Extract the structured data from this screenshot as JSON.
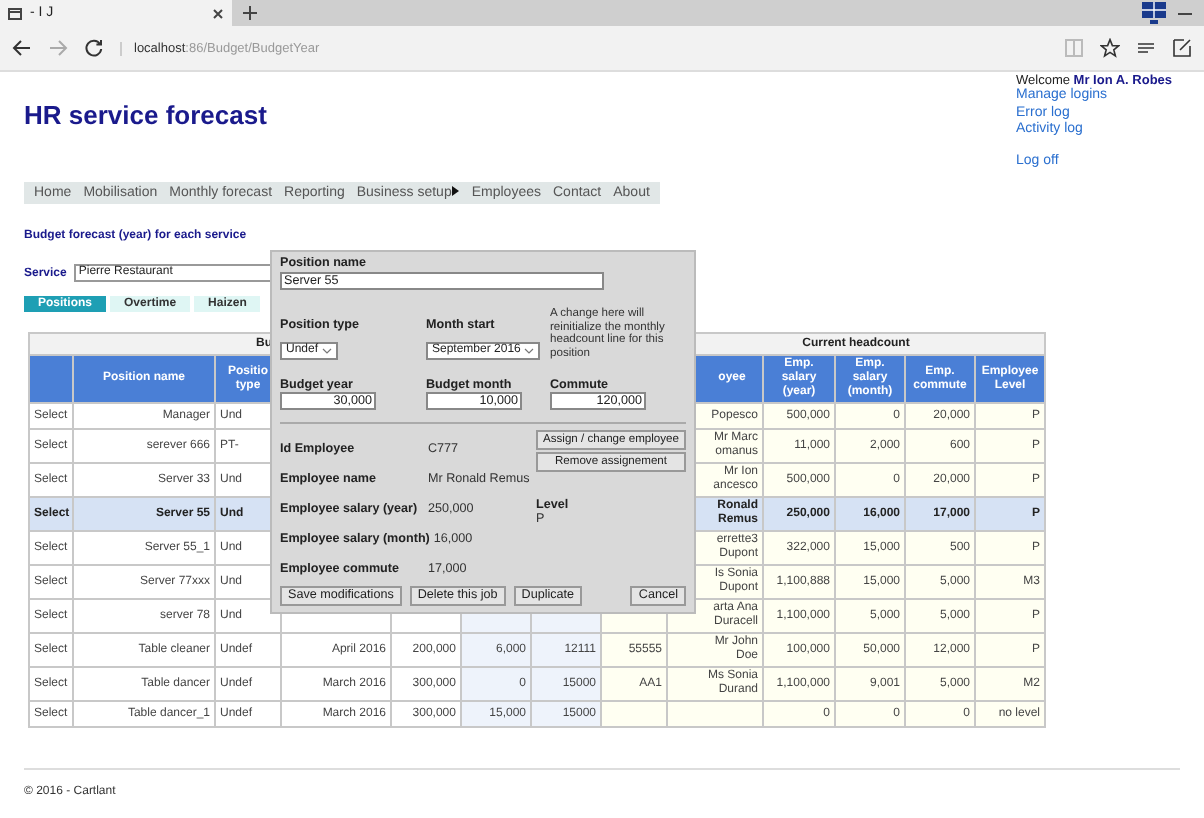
{
  "browser": {
    "tab_title": "- I J",
    "url_host": "localhost",
    "url_path": ":86/Budget/BudgetYear"
  },
  "header": {
    "title": "HR service forecast",
    "welcome": "Welcome",
    "user": "Mr Ion A. Robes",
    "links": [
      "Manage logins",
      "Error log",
      "Activity log"
    ],
    "logoff": "Log off"
  },
  "nav": [
    {
      "label": "Home",
      "submenu": false
    },
    {
      "label": "Mobilisation",
      "submenu": false
    },
    {
      "label": "Monthly forecast",
      "submenu": false
    },
    {
      "label": "Reporting",
      "submenu": false
    },
    {
      "label": "Business setup",
      "submenu": true
    },
    {
      "label": "Employees",
      "submenu": false
    },
    {
      "label": "Contact",
      "submenu": false
    },
    {
      "label": "About",
      "submenu": false
    }
  ],
  "section_title": "Budget forecast (year) for each service",
  "service": {
    "label": "Service",
    "value": "Pierre Restaurant"
  },
  "tabs": [
    {
      "label": "Positions",
      "selected": true
    },
    {
      "label": "Overtime",
      "selected": false
    },
    {
      "label": "Haizen",
      "selected": false
    }
  ],
  "table": {
    "groups": [
      {
        "label": "Bu"
      },
      {
        "label": "Current headcount"
      }
    ],
    "headers": {
      "position_name": "Position name",
      "position_type": "Positio type",
      "employee": "oyee",
      "emp_salary_year": "Emp. salary (year)",
      "emp_salary_month": "Emp. salary (month)",
      "emp_commute": "Emp. commute",
      "employee_level": "Employee Level"
    },
    "rows": [
      {
        "selected": false,
        "select": "Select",
        "position_name": "Manager",
        "position_type": "Und",
        "employee": "Popesco",
        "emp_salary_year": "500,000",
        "emp_salary_month": "0",
        "emp_commute": "20,000",
        "employee_level": "P"
      },
      {
        "selected": false,
        "select": "Select",
        "position_name": "serever 666",
        "position_type": "PT-",
        "employee": "Mr Marc omanus",
        "emp_salary_year": "11,000",
        "emp_salary_month": "2,000",
        "emp_commute": "600",
        "employee_level": "P"
      },
      {
        "selected": false,
        "select": "Select",
        "position_name": "Server 33",
        "position_type": "Und",
        "employee": "Mr Ion ancesco",
        "emp_salary_year": "500,000",
        "emp_salary_month": "0",
        "emp_commute": "20,000",
        "employee_level": "P"
      },
      {
        "selected": true,
        "select": "Select",
        "position_name": "Server 55",
        "position_type": "Und",
        "employee": "Ronald Remus",
        "emp_salary_year": "250,000",
        "emp_salary_month": "16,000",
        "emp_commute": "17,000",
        "employee_level": "P"
      },
      {
        "selected": false,
        "select": "Select",
        "position_name": "Server 55_1",
        "position_type": "Und",
        "employee": "errette3 Dupont",
        "emp_salary_year": "322,000",
        "emp_salary_month": "15,000",
        "emp_commute": "500",
        "employee_level": "P"
      },
      {
        "selected": false,
        "select": "Select",
        "position_name": "Server 77xxx",
        "position_type": "Und",
        "employee": "Is Sonia Dupont",
        "emp_salary_year": "1,100,888",
        "emp_salary_month": "15,000",
        "emp_commute": "5,000",
        "employee_level": "M3"
      },
      {
        "selected": false,
        "select": "Select",
        "position_name": "server 78",
        "position_type": "Und",
        "employee": "arta Ana Duracell",
        "emp_salary_year": "1,100,000",
        "emp_salary_month": "5,000",
        "emp_commute": "5,000",
        "employee_level": "P"
      },
      {
        "selected": false,
        "select": "Select",
        "position_name": "Table cleaner",
        "position_type": "Undef",
        "column_4": "April 2016",
        "column_5": "200,000",
        "column_6": "6,000",
        "column_7": "12111",
        "column_8": "55555",
        "employee": "Mr John Doe",
        "emp_salary_year": "100,000",
        "emp_salary_month": "50,000",
        "emp_commute": "12,000",
        "employee_level": "P"
      },
      {
        "selected": false,
        "select": "Select",
        "position_name": "Table dancer",
        "position_type": "Undef",
        "column_4": "March 2016",
        "column_5": "300,000",
        "column_6": "0",
        "column_7": "15000",
        "column_8": "AA1",
        "employee": "Ms Sonia Durand",
        "emp_salary_year": "1,100,000",
        "emp_salary_month": "9,001",
        "emp_commute": "5,000",
        "employee_level": "M2"
      },
      {
        "selected": false,
        "select": "Select",
        "position_name": "Table dancer_1",
        "position_type": "Undef",
        "column_4": "March 2016",
        "column_5": "300,000",
        "column_6": "15,000",
        "column_7": "15000",
        "emp_salary_year": "0",
        "emp_salary_month": "0",
        "emp_commute": "0",
        "employee_level": "no level"
      }
    ]
  },
  "dialog": {
    "position_name": {
      "label": "Position name",
      "value": "Server 55"
    },
    "selects": [
      {
        "label": "Position type",
        "value": "Undef"
      },
      {
        "label": "Month start",
        "value": "September 2016"
      }
    ],
    "note": "A change here will reinitialize the monthly headcount line for this position",
    "amounts": [
      {
        "label": "Budget year",
        "value": "30,000"
      },
      {
        "label": "Budget month",
        "value": "10,000"
      },
      {
        "label": "Commute",
        "value": "120,000"
      }
    ],
    "employee_fields": [
      {
        "label": "Id Employee",
        "value": "C777"
      },
      {
        "label": "Employee name",
        "value": "Mr Ronald Remus"
      },
      {
        "label": "Employee salary (year)",
        "value": "250,000"
      },
      {
        "label": "Employee salary (month)",
        "value": "16,000"
      },
      {
        "label": "Employee commute",
        "value": "17,000"
      }
    ],
    "assign_buttons": [
      "Assign / change employee",
      "Remove assignement"
    ],
    "level": {
      "label": "Level",
      "value": "P"
    },
    "buttons": [
      "Save modifications",
      "Delete this job",
      "Duplicate",
      "Cancel"
    ]
  },
  "footer": "© 2016 - Cartlant"
}
